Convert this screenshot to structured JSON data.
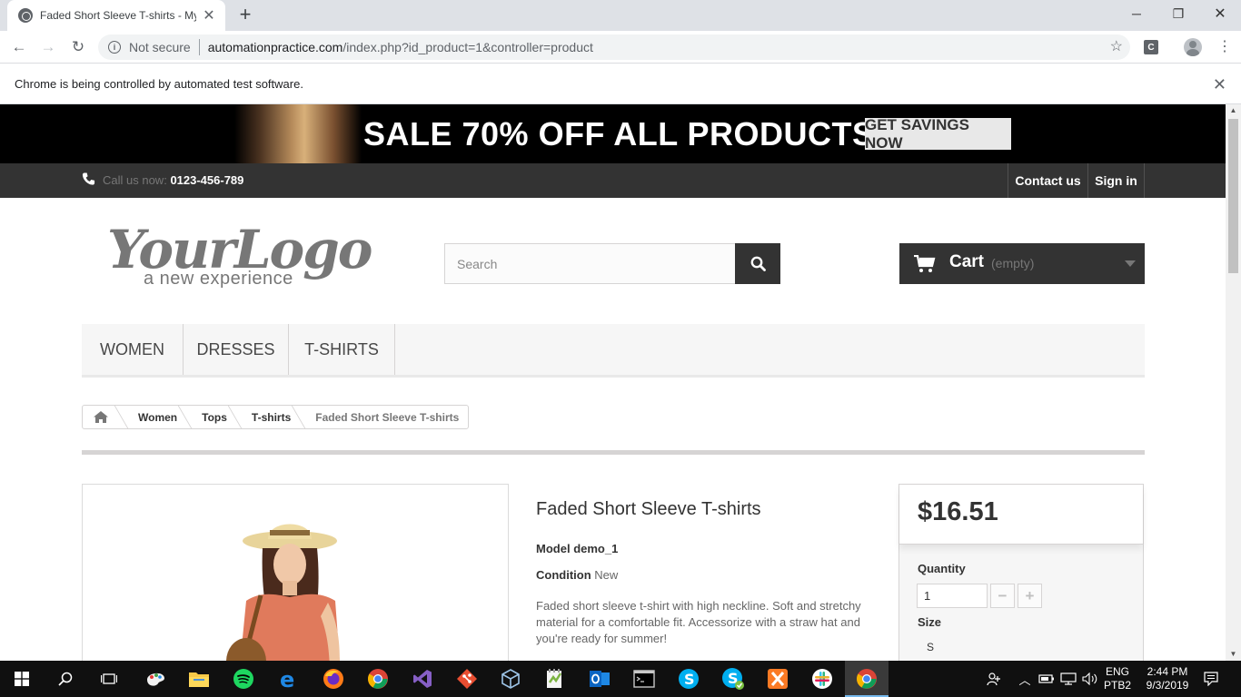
{
  "browser": {
    "tab_title": "Faded Short Sleeve T-shirts - My",
    "newtab_symbol": "+",
    "security_label": "Not secure",
    "url_host": "automationpractice.com",
    "url_path": "/index.php?id_product=1&controller=product",
    "extension_letter": "C",
    "infobar_text": "Chrome is being controlled by automated test software."
  },
  "banner": {
    "title": "SALE 70% OFF ALL PRODUCTS",
    "button": "GET SAVINGS NOW"
  },
  "header_nav": {
    "call_label": "Call us now:",
    "phone": "0123-456-789",
    "contact": "Contact us",
    "signin": "Sign in"
  },
  "logo": {
    "main": "YourLogo",
    "sub": "a new experience"
  },
  "search": {
    "placeholder": "Search"
  },
  "cart": {
    "label": "Cart",
    "status": "(empty)"
  },
  "menu": {
    "items": [
      "WOMEN",
      "DRESSES",
      "T-SHIRTS"
    ]
  },
  "breadcrumb": {
    "items": [
      "Women",
      "Tops",
      "T-shirts"
    ],
    "current": "Faded Short Sleeve T-shirts"
  },
  "product": {
    "name": "Faded Short Sleeve T-shirts",
    "model_label": "Model",
    "model": "demo_1",
    "condition_label": "Condition",
    "condition": "New",
    "description": "Faded short sleeve t-shirt with high neckline. Soft and stretchy material for a comfortable fit. Accessorize with a straw hat and you're ready for summer!",
    "price": "$16.51",
    "quantity_label": "Quantity",
    "quantity": "1",
    "size_label": "Size",
    "size": "S"
  },
  "taskbar": {
    "language": "ENG",
    "keyboard": "PTB2",
    "time": "2:44 PM",
    "date": "9/3/2019",
    "apps": [
      "start",
      "search",
      "task-view",
      "paint",
      "file-explorer",
      "spotify",
      "edge",
      "firefox",
      "chrome",
      "visual-studio",
      "git",
      "virtualbox",
      "notepad-plus-plus",
      "outlook",
      "terminal",
      "skype",
      "skype-for-business",
      "xampp",
      "slack",
      "chrome-active"
    ]
  },
  "colors": {
    "dark": "#333333",
    "banner_bg": "#000000",
    "menu_bg": "#f6f6f6",
    "taskbar_bg": "#101010"
  }
}
